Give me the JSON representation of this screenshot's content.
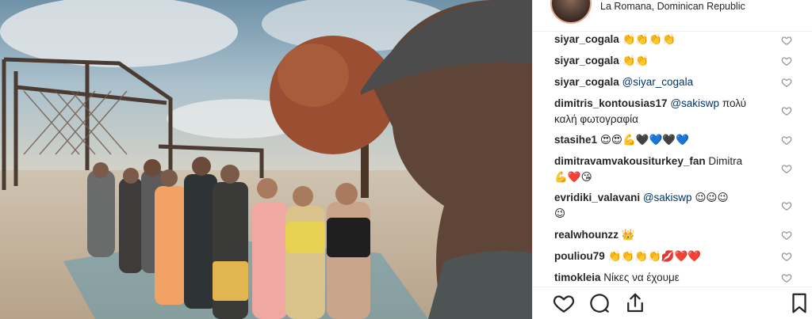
{
  "post": {
    "location": "La Romana, Dominican Republic"
  },
  "comments": [
    {
      "user": "siyar_cogala",
      "mention": "",
      "text": "",
      "emoji": "👏👏👏👏"
    },
    {
      "user": "siyar_cogala",
      "mention": "",
      "text": "",
      "emoji": "👏👏"
    },
    {
      "user": "siyar_cogala",
      "mention": "@siyar_cogala",
      "text": "",
      "emoji": ""
    },
    {
      "user": "dimitris_kontousias17",
      "mention": "@sakiswp",
      "text": "πολύ",
      "line2": "καλή φωτογραφία",
      "emoji": ""
    },
    {
      "user": "stasihe1",
      "mention": "",
      "text": "",
      "emoji": "😍😍💪🖤💙🖤💙"
    },
    {
      "user": "dimitravamvakousiturkey_fan",
      "mention": "",
      "text": "Dimitra",
      "line2": "💪❤️😘",
      "emoji": ""
    },
    {
      "user": "evridiki_valavani",
      "mention": "@sakiswp",
      "text": "",
      "emoji": "😉😉😉",
      "line2": "😉"
    },
    {
      "user": "realwhounzz",
      "mention": "",
      "text": "",
      "emoji": "👑"
    },
    {
      "user": "pouliou79",
      "mention": "",
      "text": "",
      "emoji": "👏👏👏👏💋❤️❤️"
    },
    {
      "user": "timokleia",
      "mention": "",
      "text": "Νίκες να έχουμε",
      "emoji": ""
    }
  ],
  "icons": {
    "like": "heart-icon",
    "comment": "comment-icon",
    "share": "share-icon",
    "save": "bookmark-icon",
    "comment_like": "heart-outline-icon"
  },
  "colors": {
    "text": "#262626",
    "mention": "#003569",
    "divider": "#efefef"
  }
}
